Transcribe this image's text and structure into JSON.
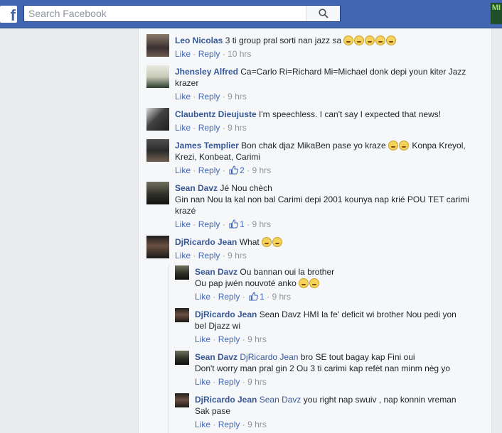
{
  "search": {
    "placeholder": "Search Facebook"
  },
  "corner_badge": "MI",
  "comments": [
    {
      "author": "Leo Nicolas",
      "text": "3 ti group pral sorti nan jazz sa",
      "emoji_count": 5,
      "like": "Like",
      "reply": "Reply",
      "time": "10 hrs"
    },
    {
      "author": "Jhensley Alfred",
      "text": "Ca=Carlo Ri=Richard Mi=Michael donk depi youn kiter Jazz",
      "text2": "krazer",
      "like": "Like",
      "reply": "Reply",
      "time": "9 hrs"
    },
    {
      "author": "Claubentz Dieujuste",
      "text": "I'm speechless. I can't say I expected that news!",
      "like": "Like",
      "reply": "Reply",
      "time": "9 hrs"
    },
    {
      "author": "James Templier",
      "text": "Bon chak djaz MikaBen pase yo kraze",
      "text_after": "Konpa Kreyol,",
      "text2": "Krezi, Konbeat, Carimi",
      "like": "Like",
      "reply": "Reply",
      "likes": "2",
      "time": "9 hrs"
    },
    {
      "author": "Sean Davz",
      "text": "Jé Nou chèch",
      "text2": "Gin nan Nou la kal non bal Carimi depi 2001 kounya nap krié POU TET carimi",
      "text3": "krazé",
      "like": "Like",
      "reply": "Reply",
      "likes": "1",
      "time": "9 hrs"
    },
    {
      "author": "DjRicardo Jean",
      "text": "What",
      "like": "Like",
      "reply": "Reply",
      "time": "9 hrs"
    }
  ],
  "replies": [
    {
      "author": "Sean Davz",
      "text": "Ou bannan oui la brother",
      "text2": "Ou pap jwén nouvoté anko",
      "like": "Like",
      "reply": "Reply",
      "likes": "1",
      "time": "9 hrs"
    },
    {
      "author": "DjRicardo Jean",
      "text": "Sean Davz HMI la fe' deficit wi brother Nou pedi yon",
      "text2": "bel Djazz wi",
      "like": "Like",
      "reply": "Reply",
      "time": "9 hrs"
    },
    {
      "author": "Sean Davz",
      "tag": "DjRicardo Jean",
      "text": "bro SE tout bagay kap Fini oui",
      "text2": "Don't worry man pral gin 2 Ou 3 ti carimi kap refèt nan minm nèg yo",
      "like": "Like",
      "reply": "Reply",
      "time": "9 hrs"
    },
    {
      "author": "DjRicardo Jean",
      "tag": "Sean Davz",
      "text": "you right nap swuiv , nap konnin vreman",
      "text2": "Sak pase",
      "like": "Like",
      "reply": "Reply",
      "time": "9 hrs"
    }
  ],
  "colors": {
    "brand": "#4267b2",
    "link": "#365899",
    "meta": "#90949c"
  }
}
